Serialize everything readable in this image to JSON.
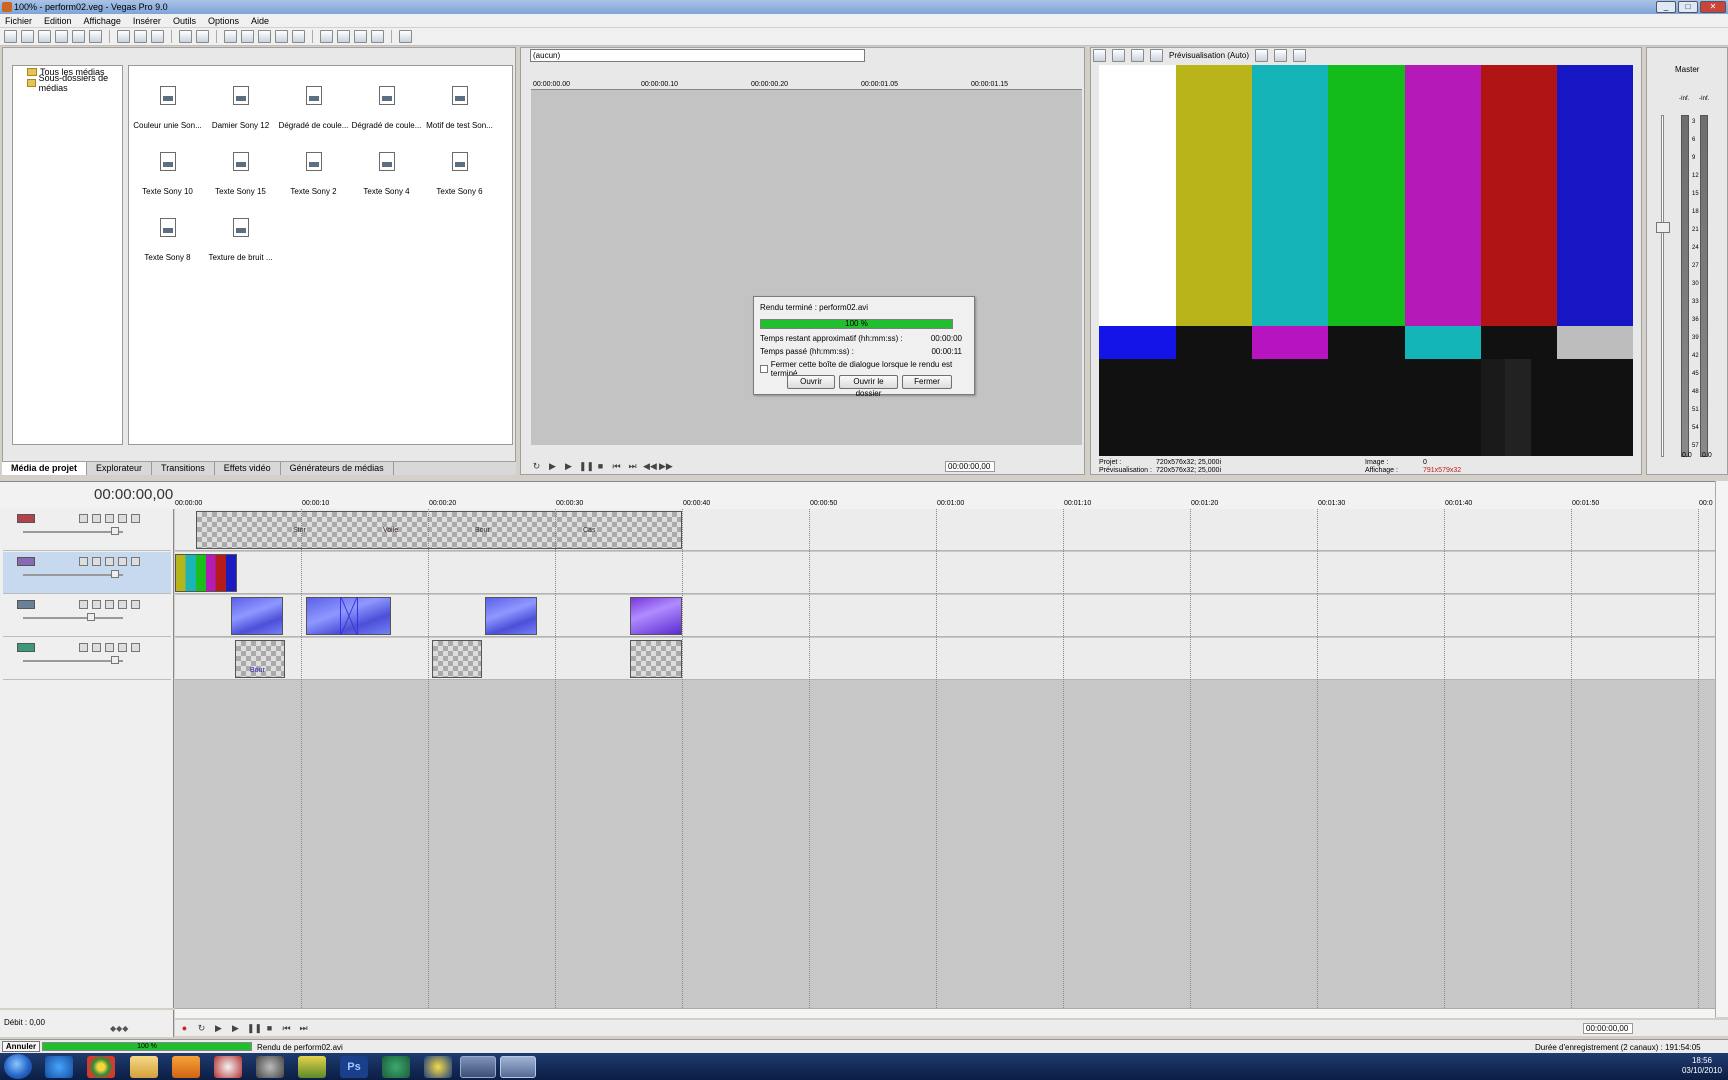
{
  "window": {
    "title": "100% - perform02.veg - Vegas Pro 9.0",
    "buttons": {
      "minimize": "_",
      "maximize": "□",
      "close": "✕"
    }
  },
  "menu": [
    "Fichier",
    "Edition",
    "Affichage",
    "Insérer",
    "Outils",
    "Options",
    "Aide"
  ],
  "media": {
    "tree": [
      "Tous les médias",
      "Sous-dossiers de médias"
    ],
    "items": [
      "Couleur unie Son...",
      "Damier Sony 12",
      "Dégradé de coule...",
      "Dégradé de coule...",
      "Motif de test Son...",
      "Texte Sony 10",
      "Texte Sony 15",
      "Texte Sony 2",
      "Texte Sony 4",
      "Texte Sony 6",
      "Texte Sony 8",
      "Texture de bruit ..."
    ],
    "tabs": [
      "Média de projet",
      "Explorateur",
      "Transitions",
      "Effets vidéo",
      "Générateurs de médias"
    ]
  },
  "trimmer": {
    "combo": "(aucun)",
    "ruler": [
      "00:00:00.00",
      "00:00:00.10",
      "00:00:00.20",
      "00:00:01.05",
      "00:00:01.15"
    ],
    "time": "00:00:00,00"
  },
  "render_dialog": {
    "title": "Rendu terminé : perform02.avi",
    "progress": "100 %",
    "progress_fraction": 1.0,
    "remaining_label": "Temps restant approximatif (hh:mm:ss) :",
    "remaining_value": "00:00:00",
    "elapsed_label": "Temps passé (hh:mm:ss) :",
    "elapsed_value": "00:00:11",
    "checkbox_label": "Fermer cette boîte de dialogue lorsque le rendu est terminé",
    "buttons": {
      "open": "Ouvrir",
      "open_folder": "Ouvrir le dossier",
      "close": "Fermer"
    }
  },
  "preview": {
    "mode": "Prévisualisation (Auto)",
    "info": {
      "project_label": "Projet :",
      "project_value": "720x576x32; 25,000i",
      "preview_label": "Prévisualisation :",
      "preview_value": "720x576x32; 25,000i",
      "frame_label": "Image :",
      "frame_value": "0",
      "display_label": "Affichage :",
      "display_value": "791x579x32"
    },
    "colors": {
      "top": [
        "#ffffff",
        "#b8b419",
        "#13b3b8",
        "#14bc1b",
        "#b51ab8",
        "#b01414",
        "#1616c4"
      ],
      "mid": [
        "#1414e8",
        "#111111",
        "#b614be",
        "#111111",
        "#12b4b8",
        "#111111",
        "#bdbdbd"
      ]
    }
  },
  "master": {
    "label": "Master",
    "scale": [
      "-Inf.",
      "-Inf.",
      "3",
      "6",
      "9",
      "12",
      "15",
      "18",
      "21",
      "24",
      "27",
      "30",
      "33",
      "36",
      "39",
      "42",
      "45",
      "48",
      "51",
      "54",
      "57"
    ],
    "bottom": [
      "0.0",
      "0.0"
    ]
  },
  "timeline": {
    "time": "00:00:00,00",
    "ruler": [
      "00:00:00",
      "00:00:10",
      "00:00:20",
      "00:00:30",
      "00:00:40",
      "00:00:50",
      "00:01:00",
      "00:01:10",
      "00:01:20",
      "00:01:30",
      "00:01:40",
      "00:01:50",
      "00:0"
    ],
    "clip_labels": [
      "Bour",
      "Stor",
      "Voile",
      "Cas",
      "Bour"
    ],
    "rate_label": "Débit : 0,00",
    "transport_time": "00:00:00,00"
  },
  "status": {
    "cancel": "Annuler",
    "progress": "100 %",
    "text": "Rendu de perform02.avi",
    "right": "Durée d'enregistrement (2 canaux) : 191:54:05"
  },
  "taskbar": {
    "time": "18:56",
    "date": "03/10/2010"
  }
}
